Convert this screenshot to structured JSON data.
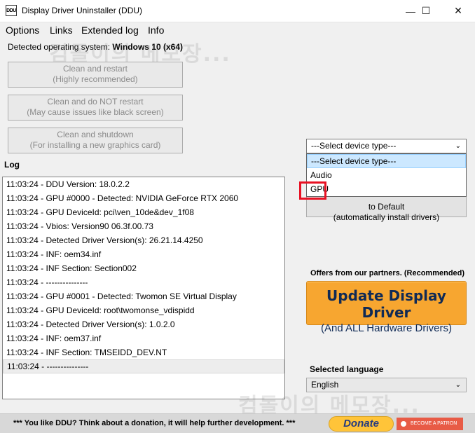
{
  "window": {
    "title": "Display Driver Uninstaller (DDU)",
    "icon_text": "DDU",
    "minimize": "—",
    "maximize": "☐",
    "close": "✕"
  },
  "menu": [
    "Options",
    "Links",
    "Extended log",
    "Info"
  ],
  "os": {
    "label": "Detected operating system: ",
    "value": "Windows 10 (x64)"
  },
  "watermark": "컴돌이의 메모장...",
  "actions": [
    {
      "line1": "Clean and restart",
      "line2": "(Highly recommended)"
    },
    {
      "line1": "Clean and do NOT restart",
      "line2": "(May cause issues like black screen)"
    },
    {
      "line1": "Clean and shutdown",
      "line2": "(For installing a new graphics card)"
    }
  ],
  "log": {
    "title": "Log",
    "lines": [
      "11:03:24 - DDU Version: 18.0.2.2",
      "11:03:24 - GPU #0000 - Detected: NVIDIA GeForce RTX 2060",
      "11:03:24 - GPU DeviceId: pci\\ven_10de&dev_1f08",
      "11:03:24 - Vbios: Version90 06.3f.00.73",
      "11:03:24 - Detected Driver Version(s): 26.21.14.4250",
      "11:03:24 - INF: oem34.inf",
      "11:03:24 - INF Section: Section002",
      "11:03:24 - ---------------",
      "11:03:24 - GPU #0001 - Detected: Twomon SE Virtual Display",
      "11:03:24 - GPU DeviceId: root\\twomonse_vdispidd",
      "11:03:24 - Detected Driver Version(s): 1.0.2.0",
      "11:03:24 - INF: oem37.inf",
      "11:03:24 - INF Section: TMSEIDD_DEV.NT",
      "11:03:24 - ---------------"
    ]
  },
  "device_type": {
    "selected": "---Select device type---",
    "options": [
      "---Select device type---",
      "Audio",
      "GPU"
    ],
    "chevron": "⌄"
  },
  "restore": {
    "line1": "to Default",
    "line2": "(automatically install drivers)"
  },
  "partners": {
    "label": "Offers from our partners. (Recommended)",
    "line1": "Update Display Driver",
    "line2": "(And ALL Hardware Drivers)"
  },
  "language": {
    "label": "Selected language",
    "value": "English",
    "chevron": "⌄"
  },
  "footer": {
    "text": "*** You like DDU? Think about a donation, it will help further development. ***",
    "donate": "Donate",
    "patron": "BECOME A PATRON"
  }
}
